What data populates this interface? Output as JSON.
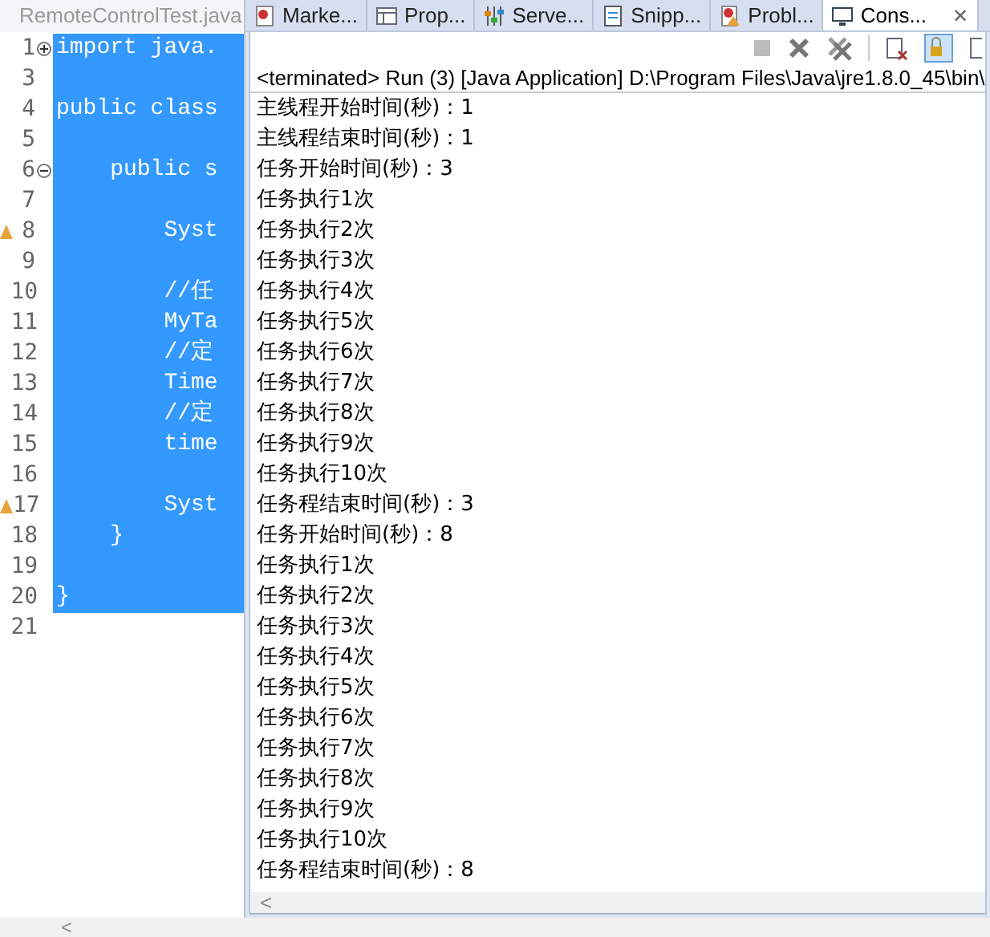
{
  "editor": {
    "tab": {
      "title": "RemoteControlTest.java"
    },
    "lines": [
      {
        "number": "1",
        "code": "import java.",
        "selected": true,
        "kind": "expand"
      },
      {
        "number": "3",
        "selected": true
      },
      {
        "number": "4",
        "code": "public class",
        "selected": true
      },
      {
        "number": "5",
        "selected": true
      },
      {
        "number": "6",
        "code": "    public s",
        "selected": true,
        "kind": "collapse"
      },
      {
        "number": "7",
        "selected": true
      },
      {
        "number": "8",
        "code": "        Syst",
        "selected": true,
        "kind": "warning"
      },
      {
        "number": "9",
        "selected": true
      },
      {
        "number": "10",
        "code": "        //任",
        "selected": true
      },
      {
        "number": "11",
        "code": "        MyTa",
        "selected": true
      },
      {
        "number": "12",
        "code": "        //定",
        "selected": true
      },
      {
        "number": "13",
        "code": "        Time",
        "selected": true
      },
      {
        "number": "14",
        "code": "        //定",
        "selected": true
      },
      {
        "number": "15",
        "code": "        time",
        "selected": true
      },
      {
        "number": "16",
        "selected": true
      },
      {
        "number": "17",
        "code": "        Syst",
        "selected": true,
        "kind": "warning"
      },
      {
        "number": "18",
        "code": "    }",
        "selected": true
      },
      {
        "number": "19",
        "selected": true
      },
      {
        "number": "20",
        "code": "}",
        "selected": true
      },
      {
        "number": "21",
        "selected": false
      }
    ],
    "scroll_arrow": "<"
  },
  "views": {
    "tabs": [
      {
        "label": "Marke...",
        "kind": "markers",
        "selected": false
      },
      {
        "label": "Prop...",
        "kind": "properties",
        "selected": false
      },
      {
        "label": "Serve...",
        "kind": "servers",
        "selected": false
      },
      {
        "label": "Snipp...",
        "kind": "snippets",
        "selected": false
      },
      {
        "label": "Probl...",
        "kind": "problems",
        "selected": false
      },
      {
        "label": "Cons...",
        "kind": "console",
        "selected": true
      }
    ],
    "close": "✕"
  },
  "console": {
    "header": "<terminated> Run (3) [Java Application] D:\\Program Files\\Java\\jre1.8.0_45\\bin\\",
    "output": [
      "主线程开始时间(秒)：1",
      "主线程结束时间(秒)：1",
      "任务开始时间(秒)：3",
      "任务执行1次",
      "任务执行2次",
      "任务执行3次",
      "任务执行4次",
      "任务执行5次",
      "任务执行6次",
      "任务执行7次",
      "任务执行8次",
      "任务执行9次",
      "任务执行10次",
      "任务程结束时间(秒)：3",
      "任务开始时间(秒)：8",
      "任务执行1次",
      "任务执行2次",
      "任务执行3次",
      "任务执行4次",
      "任务执行5次",
      "任务执行6次",
      "任务执行7次",
      "任务执行8次",
      "任务执行9次",
      "任务执行10次",
      "任务程结束时间(秒)：8"
    ],
    "scroll_arrow": "<"
  }
}
